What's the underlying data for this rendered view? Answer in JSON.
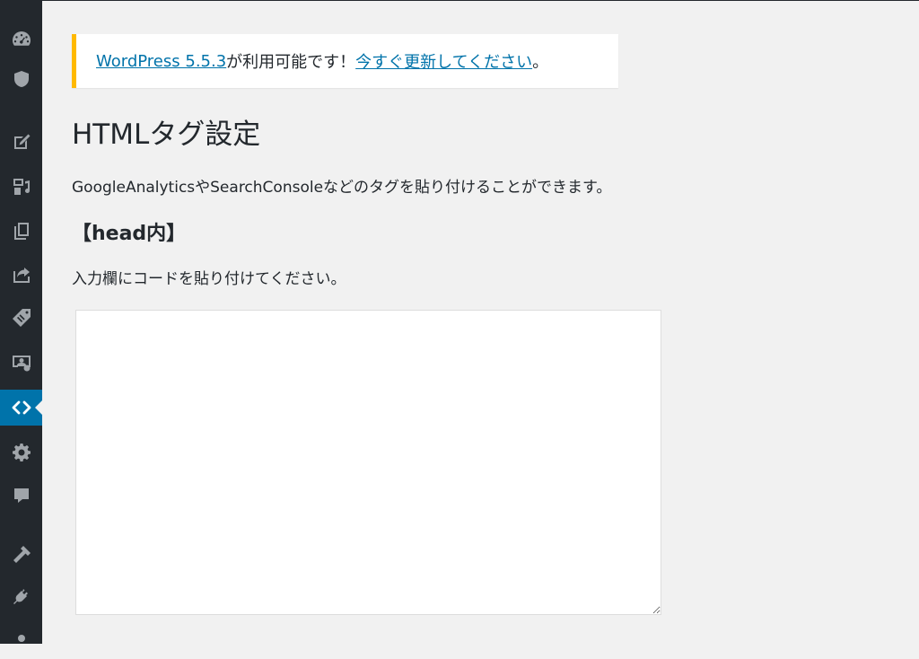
{
  "sidebar": {
    "items": [
      {
        "icon": "dashboard-icon"
      },
      {
        "icon": "shield-icon"
      },
      {
        "icon": "posts-icon"
      },
      {
        "icon": "media-icon"
      },
      {
        "icon": "pages-icon"
      },
      {
        "icon": "export-icon"
      },
      {
        "icon": "tag-icon"
      },
      {
        "icon": "profile-card-icon"
      },
      {
        "icon": "code-icon",
        "active": true
      },
      {
        "icon": "gear-icon"
      },
      {
        "icon": "comments-icon"
      },
      {
        "icon": "tools-icon"
      },
      {
        "icon": "plugins-icon"
      },
      {
        "icon": "users-icon"
      }
    ],
    "active_color": "#0073aa",
    "background": "#23282d"
  },
  "notice": {
    "version_link": "WordPress 5.5.3",
    "middle_text": " が利用可能です！",
    "update_link": "今すぐ更新してください",
    "end_text": "。",
    "accent_color": "#ffb900"
  },
  "page": {
    "title": "HTMLタグ設定",
    "description": "GoogleAnalyticsやSearchConsoleなどのタグを貼り付けることができます。",
    "section_heading": "【head内】",
    "instruction": "入力欄にコードを貼り付けてください。",
    "textarea_value": ""
  }
}
